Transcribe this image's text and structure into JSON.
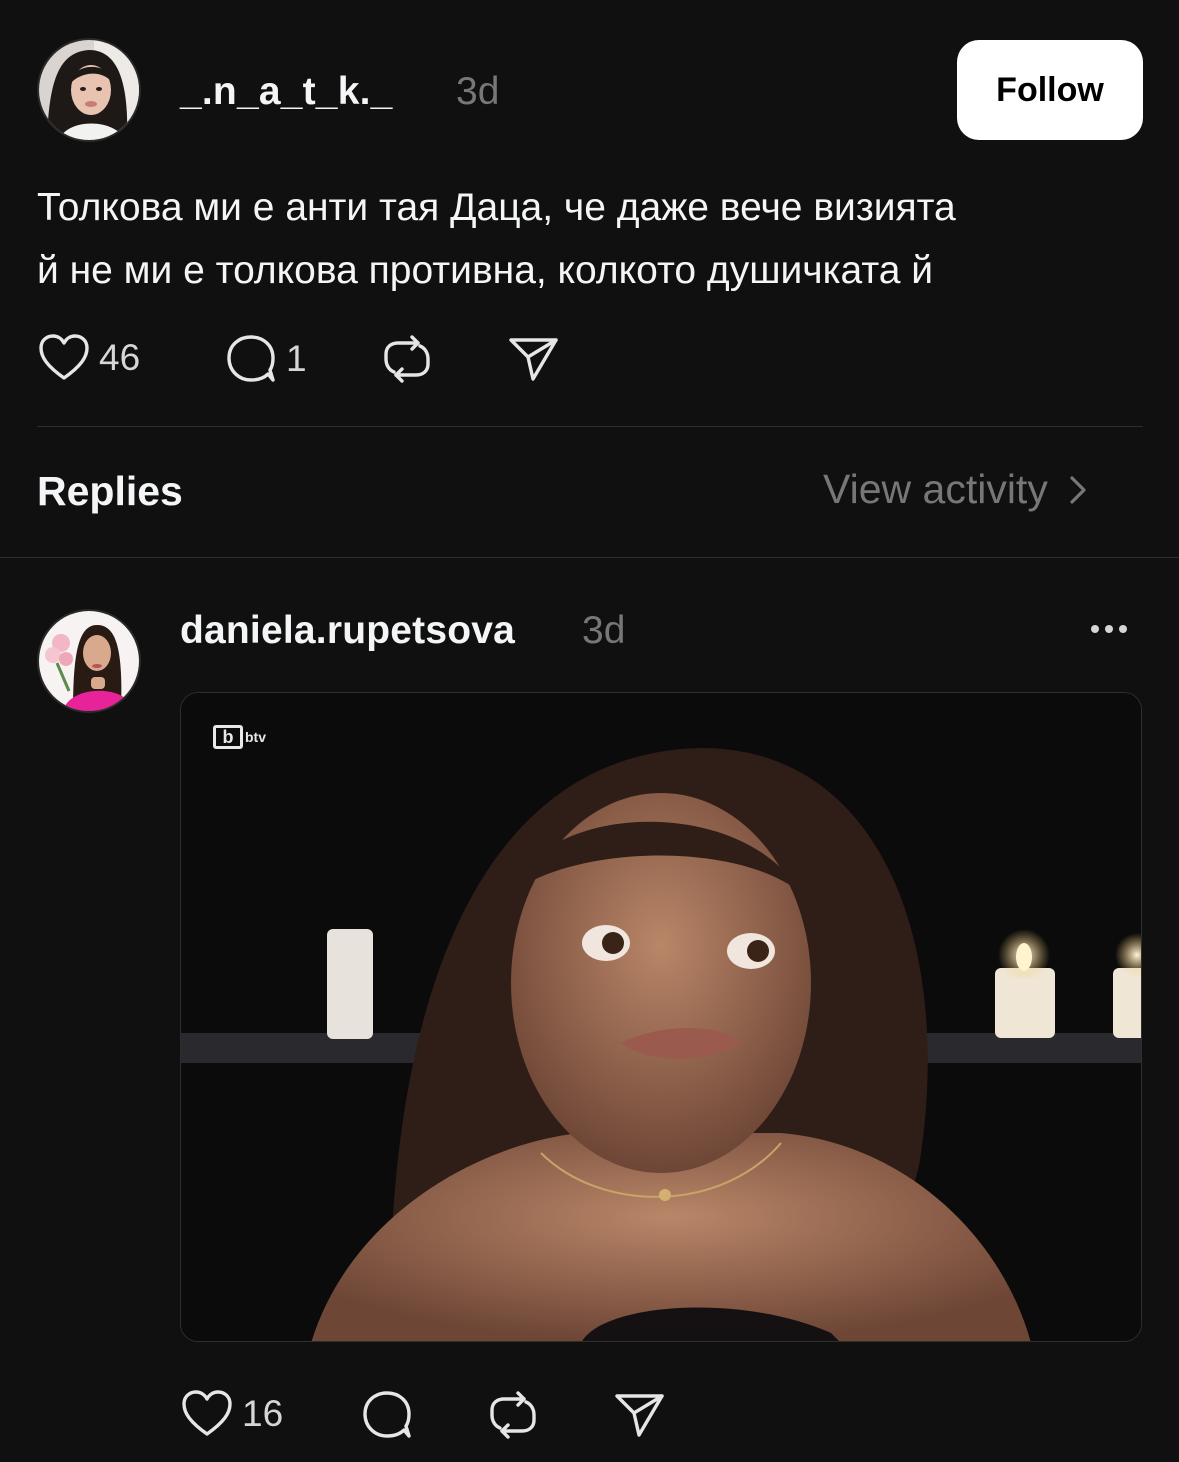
{
  "post": {
    "username": "_.n_a_t_k._",
    "timestamp": "3d",
    "follow_label": "Follow",
    "text_line1": "Толкова ми е анти тая Даца, че даже вече визията",
    "text_line2": "й не ми е толкова противна, колкото душичката й",
    "like_count": "46",
    "reply_count": "1"
  },
  "replies_header": {
    "title": "Replies",
    "view_activity_label": "View activity"
  },
  "reply": {
    "username": "daniela.rupetsova",
    "timestamp": "3d",
    "media_watermark": "btv",
    "like_count": "16"
  },
  "icons": {
    "like": "heart-icon",
    "reply": "speech-bubble-icon",
    "repost": "repost-icon",
    "share": "send-icon",
    "chevron": "chevron-right-icon",
    "more": "more-dots-icon"
  },
  "colors": {
    "background": "#101010",
    "text_primary": "#f3f5f7",
    "text_secondary": "#777777",
    "follow_button_bg": "#ffffff",
    "divider": "#2d2d2d"
  }
}
